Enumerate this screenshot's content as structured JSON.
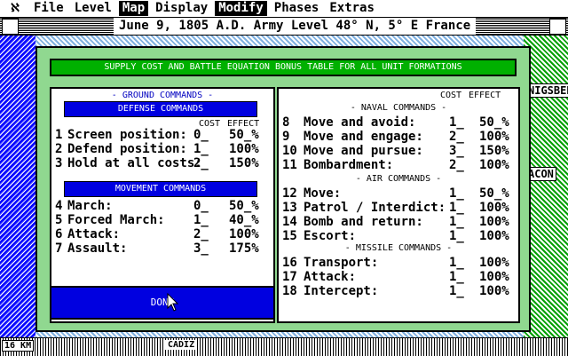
{
  "menubar": {
    "logo_glyph": "ℵ",
    "items": [
      "File",
      "Level",
      "Map",
      "Display",
      "Modify",
      "Phases",
      "Extras"
    ],
    "active": [
      "Map",
      "Modify"
    ]
  },
  "window": {
    "title": "June 9, 1805 A.D. Army Level 48° N, 5° E France"
  },
  "map": {
    "labels": [
      "NIGSBER",
      "ACON"
    ],
    "scale": "16 KM",
    "city": "CADIZ"
  },
  "dialog": {
    "title": "SUPPLY COST AND BATTLE EQUATION BONUS TABLE FOR ALL UNIT FORMATIONS",
    "left": {
      "section": "- GROUND COMMANDS -",
      "defense_bar": "DEFENSE COMMANDS",
      "col_cost": "COST",
      "col_effect": "EFFECT",
      "defense_rows": [
        {
          "num": "1",
          "name": "Screen position:",
          "cost": "0_",
          "effect": "50_%"
        },
        {
          "num": "2",
          "name": "Defend position:",
          "cost": "1_",
          "effect": "100%"
        },
        {
          "num": "3",
          "name": "Hold at all costs:",
          "cost": "2_",
          "effect": "150%"
        }
      ],
      "movement_bar": "MOVEMENT COMMANDS",
      "movement_rows": [
        {
          "num": "4",
          "name": "March:",
          "cost": "0_",
          "effect": "50_%"
        },
        {
          "num": "5",
          "name": "Forced March:",
          "cost": "1_",
          "effect": "40_%"
        },
        {
          "num": "6",
          "name": "Attack:",
          "cost": "2_",
          "effect": "100%"
        },
        {
          "num": "7",
          "name": "Assault:",
          "cost": "3_",
          "effect": "175%"
        }
      ]
    },
    "right": {
      "col_cost": "COST",
      "col_effect": "EFFECT",
      "naval_head": "- NAVAL COMMANDS -",
      "naval_rows": [
        {
          "num": "8",
          "name": "Move and avoid:",
          "cost": "1_",
          "effect": "50_%"
        },
        {
          "num": "9",
          "name": "Move and engage:",
          "cost": "2_",
          "effect": "100%"
        },
        {
          "num": "10",
          "name": "Move and pursue:",
          "cost": "3_",
          "effect": "150%"
        },
        {
          "num": "11",
          "name": "Bombardment:",
          "cost": "2_",
          "effect": "100%"
        }
      ],
      "air_head": "- AIR COMMANDS -",
      "air_rows": [
        {
          "num": "12",
          "name": "Move:",
          "cost": "1_",
          "effect": "50_%"
        },
        {
          "num": "13",
          "name": "Patrol / Interdict:",
          "cost": "1_",
          "effect": "100%"
        },
        {
          "num": "14",
          "name": "Bomb and return:",
          "cost": "1_",
          "effect": "100%"
        },
        {
          "num": "15",
          "name": "Escort:",
          "cost": "1_",
          "effect": "100%"
        }
      ],
      "missile_head": "- MISSILE COMMANDS -",
      "missile_rows": [
        {
          "num": "16",
          "name": "Transport:",
          "cost": "1_",
          "effect": "100%"
        },
        {
          "num": "17",
          "name": "Attack:",
          "cost": "1_",
          "effect": "100%"
        },
        {
          "num": "18",
          "name": "Intercept:",
          "cost": "1_",
          "effect": "100%"
        }
      ]
    },
    "done_label": "DONE"
  }
}
